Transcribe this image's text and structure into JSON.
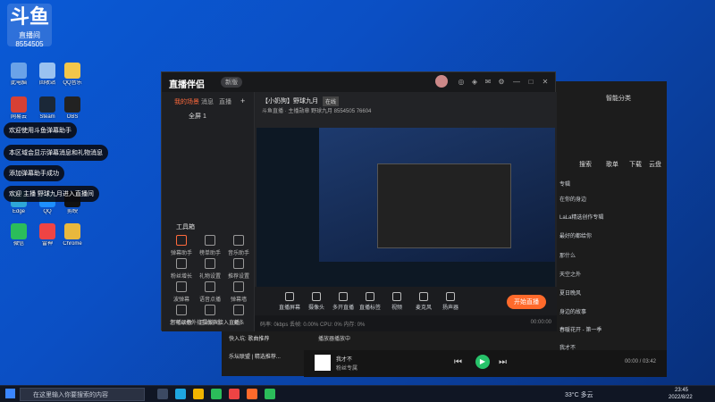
{
  "overlay": {
    "logo_text": "斗鱼",
    "room_label": "直播间",
    "room_number": "8554505"
  },
  "chat": [
    "欢迎使用斗鱼弹幕助手",
    "本区域会显示弹幕消息和礼物消息",
    "添加弹幕助手成功",
    "欢迎 主播 野球九月进入直播间"
  ],
  "desktop_icons": [
    {
      "label": "此电脑",
      "color": "#6aa2e8"
    },
    {
      "label": "回收站",
      "color": "#9ac2f0"
    },
    {
      "label": "QQ音乐",
      "color": "#f3c64a"
    },
    {
      "label": "网易云",
      "color": "#d64034"
    },
    {
      "label": "Steam",
      "color": "#1b2838"
    },
    {
      "label": "OBS",
      "color": "#222"
    },
    {
      "label": "Edge",
      "color": "#2ea7d8"
    },
    {
      "label": "QQ",
      "color": "#1e90ff"
    },
    {
      "label": "剪映",
      "color": "#111"
    },
    {
      "label": "微信",
      "color": "#2bbd5a"
    },
    {
      "label": "雷神",
      "color": "#e44"
    },
    {
      "label": "Chrome",
      "color": "#e9b83d"
    }
  ],
  "app": {
    "brand": "直播伴侣",
    "version": "新版",
    "tabs": [
      "我的场景",
      "消息",
      "直播"
    ],
    "scene_label": "全屏 1",
    "toolbox_title": "工具箱",
    "tools": [
      "弹幕助手",
      "榜单助手",
      "音乐助手",
      "粉丝增长",
      "礼物设置",
      "推荐设置",
      "波弹幕",
      "语音点播",
      "弹幕墙",
      "开播录像",
      "互动游戏",
      "更多"
    ],
    "stream_title": "【小奶狗】野球九月",
    "stream_tag": "在线",
    "stream_info": "斗鱼直播 · 主播勋章  野球九月  8554505  76604",
    "bottom_tools": [
      "直播屏幕",
      "摄像头",
      "多开直播",
      "直播标签",
      "视频",
      "麦克风",
      "扬声器"
    ],
    "go_live_label": "开始直播",
    "status_text": "码率: 0kbps  丢帧: 0.00%  CPU: 0%  内存: 0%",
    "status_time": "00:00:00",
    "hint_text": "您可以把外接摄像头接入直播..."
  },
  "music": {
    "header": "智能分类",
    "search": "搜索",
    "tabs": [
      "歌单",
      "下载",
      "云盘"
    ],
    "sections": [
      "专辑",
      "在你的身边",
      "LaLa精选创作专辑",
      "最好的都给你",
      "那什么",
      "天空之外",
      "夏日晚风",
      "身边的故事",
      "春暖花开 - 第一季",
      "我才不"
    ],
    "queue": [
      "快入坑: 歌曲推荐",
      "乐坛联盟 | 精选推荐..."
    ],
    "now_playing": "播放器播放中",
    "song_title": "我才不",
    "song_artist": "粉丝专属",
    "time": "00:00 / 03:42"
  },
  "taskbar": {
    "search_placeholder": "在这里输入你要搜索的内容",
    "weather": "33°C 多云",
    "clock_time": "23:45",
    "clock_date": "2022/8/22"
  }
}
